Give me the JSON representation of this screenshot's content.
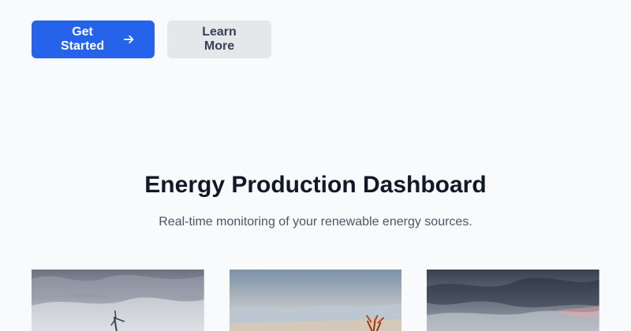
{
  "hero": {
    "primary_button": "Get Started",
    "secondary_button": "Learn More"
  },
  "dashboard": {
    "title": "Energy Production Dashboard",
    "subtitle": "Real-time monitoring of your renewable energy sources."
  },
  "cards": [
    {
      "image_semantic": "wind-turbine-photo"
    },
    {
      "image_semantic": "solar-landscape-photo"
    },
    {
      "image_semantic": "stormy-coast-photo"
    }
  ],
  "colors": {
    "background": "#f8fafc",
    "primary": "#2563eb",
    "secondary": "#e5e7eb",
    "heading": "#111827",
    "text": "#4b5563"
  }
}
